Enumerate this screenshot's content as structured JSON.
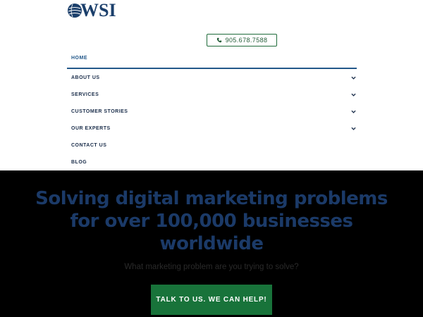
{
  "logo": {
    "text": "WSI"
  },
  "phone": {
    "number": "905.678.7588",
    "icon": "phone-icon"
  },
  "nav": {
    "items": [
      {
        "label": "HOME",
        "has_submenu": false,
        "active": true
      },
      {
        "label": "ABOUT US",
        "has_submenu": true
      },
      {
        "label": "SERVICES",
        "has_submenu": true
      },
      {
        "label": "CUSTOMER STORIES",
        "has_submenu": true
      },
      {
        "label": "OUR EXPERTS",
        "has_submenu": true
      },
      {
        "label": "CONTACT US",
        "has_submenu": false
      },
      {
        "label": "BLOG",
        "has_submenu": false
      }
    ]
  },
  "hero": {
    "title_lines": [
      "Solving digital marketing problems",
      "for over 100,000 businesses",
      "worldwide"
    ],
    "subtitle": "What marketing problem are you trying to solve?",
    "cta_label": "TALK TO US. WE CAN HELP!"
  },
  "colors": {
    "brand_blue": "#1b3f6b",
    "accent_green": "#18733a",
    "hero_background": "#000000"
  }
}
